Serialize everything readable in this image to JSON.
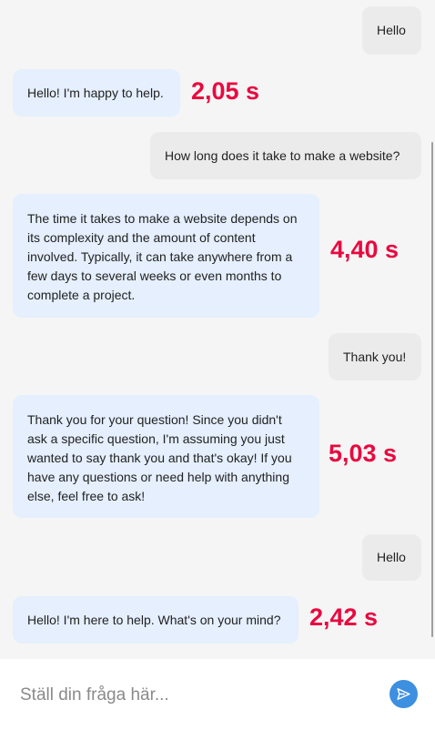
{
  "messages": [
    {
      "role": "user",
      "text": "Hello"
    },
    {
      "role": "bot",
      "text": "Hello! I'm happy to help.",
      "latency": "2,05 s"
    },
    {
      "role": "user",
      "text": "How long does it take to make a website?"
    },
    {
      "role": "bot",
      "text": "The time it takes to make a website depends on its complexity and the amount of content involved. Typically, it can take anywhere from a few days to several weeks or even months to complete a project.",
      "latency": "4,40 s"
    },
    {
      "role": "user",
      "text": "Thank you!"
    },
    {
      "role": "bot",
      "text": "Thank you for your question! Since you didn't ask a specific question, I'm assuming you just wanted to say thank you and that's okay! If you have any questions or need help with anything else, feel free to ask!",
      "latency": "5,03 s"
    },
    {
      "role": "user",
      "text": "Hello"
    },
    {
      "role": "bot",
      "text": "Hello! I'm here to help. What's on your mind?",
      "latency": "2,42 s"
    }
  ],
  "composer": {
    "placeholder": "Ställ din fråga här...",
    "value": "",
    "send_icon": "send-icon"
  },
  "colors": {
    "user_bubble": "#ebebeb",
    "bot_bubble": "#e5effd",
    "latency": "#e8093f",
    "send_button": "#3d8fe0"
  }
}
